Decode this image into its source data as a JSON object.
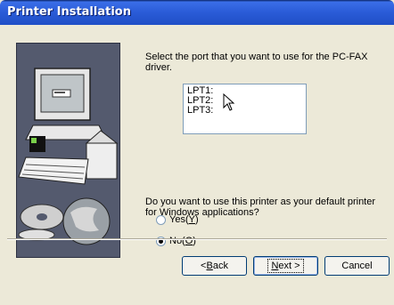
{
  "window": {
    "title": "Printer Installation"
  },
  "port_prompt": "Select the port that you want to use for the PC-FAX driver.",
  "ports": [
    "LPT1:",
    "LPT2:",
    "LPT3:"
  ],
  "default_question": "Do you want to use this printer as your default printer for Windows applications?",
  "options": [
    {
      "label_pre": "Yes(",
      "mnemonic": "Y",
      "label_post": ")",
      "selected": false
    },
    {
      "label_pre": "No(",
      "mnemonic": "O",
      "label_post": ")",
      "selected": true
    }
  ],
  "buttons": {
    "back": {
      "pre": "< ",
      "mnemonic": "B",
      "post": "ack"
    },
    "next": {
      "mnemonic": "N",
      "post": "ext >"
    },
    "cancel": "Cancel"
  }
}
